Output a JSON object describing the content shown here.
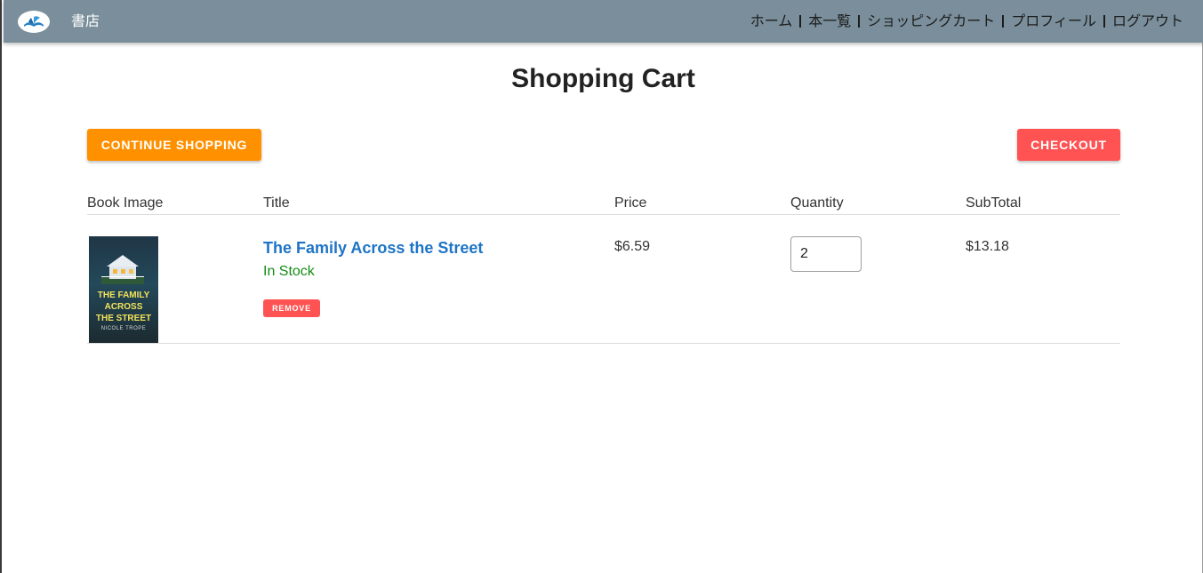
{
  "navbar": {
    "brand": "書店",
    "links": [
      "ホーム",
      "本一覧",
      "ショッピングカート",
      "プロフィール",
      "ログアウト"
    ]
  },
  "page": {
    "title": "Shopping Cart"
  },
  "actions": {
    "continue_label": "Continue Shopping",
    "checkout_label": "Checkout"
  },
  "table": {
    "headers": [
      "Book Image",
      "Title",
      "Price",
      "Quantity",
      "SubTotal"
    ],
    "rows": [
      {
        "cover": {
          "title_line1": "THE FAMILY",
          "title_line2": "ACROSS",
          "title_line3": "THE STREET",
          "author": "NICOLE TROPE"
        },
        "title": "The Family Across the Street",
        "stock": "In Stock",
        "remove_label": "REMOVE",
        "price": "$6.59",
        "quantity": "2",
        "subtotal": "$13.18"
      }
    ]
  },
  "colors": {
    "navbar": "#7a8f9b",
    "continue_button": "#ff9000",
    "checkout_button": "#ff5252",
    "link": "#1e74c6",
    "in_stock": "#138d13"
  },
  "icons": {
    "logo": "book-logo-icon"
  }
}
